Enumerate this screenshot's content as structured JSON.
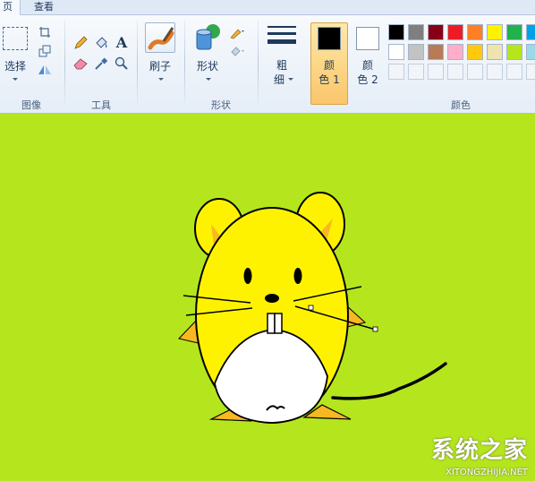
{
  "tabs": [
    {
      "label": "页"
    },
    {
      "label": "查看"
    }
  ],
  "ribbon": {
    "image_group": {
      "label": "图像",
      "select_label": "选择"
    },
    "tools_group": {
      "label": "工具"
    },
    "brush_label": "刷子",
    "shapes_group": {
      "label": "形状",
      "shapes_label": "形状"
    },
    "size": {
      "line1": "粗",
      "line2": "细"
    },
    "color1": {
      "line1": "颜",
      "line2": "色 1",
      "value": "#000000"
    },
    "color2": {
      "line1": "颜",
      "line2": "色 2",
      "value": "#ffffff"
    },
    "colors_group": {
      "label": "颜色"
    },
    "palette_row1": [
      "#000000",
      "#7f7f7f",
      "#880015",
      "#ed1c24",
      "#ff7f27",
      "#fff200",
      "#22b14c",
      "#00a2e8"
    ],
    "palette_row2": [
      "#ffffff",
      "#c3c3c3",
      "#b97a57",
      "#ffaec9",
      "#ffc90e",
      "#efe4b0",
      "#b5e61d",
      "#99d9ea"
    ]
  },
  "canvas": {
    "background": "#b5e61d"
  },
  "watermark": {
    "main": "系统之家",
    "sub": "XITONGZHIJIA.NET"
  }
}
